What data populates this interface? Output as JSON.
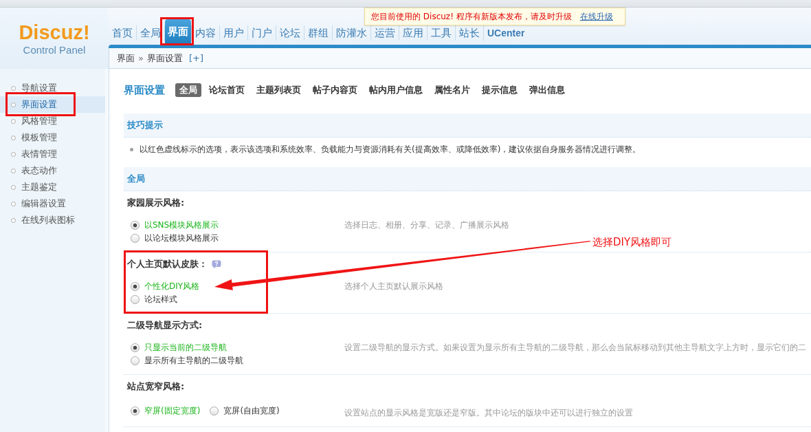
{
  "notice": {
    "text": "您目前使用的 Discuz! 程序有新版本发布，请及时升级",
    "link": "在线升级"
  },
  "logo": {
    "title": "Discuz!",
    "subtitle": "Control Panel"
  },
  "nav": [
    {
      "label": "首页",
      "kind": "menu",
      "selected": false,
      "marked": false
    },
    {
      "label": "全局",
      "kind": "menu",
      "selected": false,
      "marked": false
    },
    {
      "label": "界面",
      "kind": "menu",
      "selected": true,
      "marked": true
    },
    {
      "label": "内容",
      "kind": "menu",
      "selected": false,
      "marked": false
    },
    {
      "label": "用户",
      "kind": "menu",
      "selected": false,
      "marked": false
    },
    {
      "label": "门户",
      "kind": "menu",
      "selected": false,
      "marked": false
    },
    {
      "label": "论坛",
      "kind": "menu",
      "selected": false,
      "marked": false
    },
    {
      "label": "群组",
      "kind": "menu",
      "selected": false,
      "marked": false
    },
    {
      "label": "防灌水",
      "kind": "menu",
      "selected": false,
      "marked": false
    },
    {
      "label": "运营",
      "kind": "menu",
      "selected": false,
      "marked": false
    },
    {
      "label": "应用",
      "kind": "menu",
      "selected": false,
      "marked": false
    },
    {
      "label": "工具",
      "kind": "menu",
      "selected": false,
      "marked": false
    },
    {
      "label": "站长",
      "kind": "menu",
      "selected": false,
      "marked": false
    },
    {
      "label": "UCenter",
      "kind": "app",
      "selected": false,
      "marked": false
    }
  ],
  "breadcrumb": {
    "items": [
      "界面",
      "界面设置"
    ],
    "separator": "»",
    "toggle": "[+]"
  },
  "sidebar": {
    "items": [
      {
        "label": "导航设置",
        "selected": false,
        "marked": false
      },
      {
        "label": "界面设置",
        "selected": true,
        "marked": true
      },
      {
        "label": "风格管理",
        "selected": false,
        "marked": false
      },
      {
        "label": "模板管理",
        "selected": false,
        "marked": false
      },
      {
        "label": "表情管理",
        "selected": false,
        "marked": false
      },
      {
        "label": "表态动作",
        "selected": false,
        "marked": false
      },
      {
        "label": "主题鉴定",
        "selected": false,
        "marked": false
      },
      {
        "label": "编辑器设置",
        "selected": false,
        "marked": false
      },
      {
        "label": "在线列表图标",
        "selected": false,
        "marked": false
      }
    ]
  },
  "page": {
    "title": "界面设置",
    "tabs": [
      {
        "label": "全局",
        "selected": true
      },
      {
        "label": "论坛首页",
        "selected": false
      },
      {
        "label": "主题列表页",
        "selected": false
      },
      {
        "label": "帖子内容页",
        "selected": false
      },
      {
        "label": "帖内用户信息",
        "selected": false
      },
      {
        "label": "属性名片",
        "selected": false
      },
      {
        "label": "提示信息",
        "selected": false
      },
      {
        "label": "弹出信息",
        "selected": false
      }
    ]
  },
  "tips": {
    "title": "技巧提示",
    "items": [
      "以红色虚线标示的选项，表示该选项和系统效率、负载能力与资源消耗有关(提高效率、或降低效率)，建议依据自身服务器情况进行调整。"
    ]
  },
  "settings_section": {
    "title": "全局",
    "settings": [
      {
        "label": "家园展示风格:",
        "kind": "stacked",
        "help": false,
        "marked": false,
        "options": [
          {
            "label": "以SNS模块风格展示",
            "selected": true
          },
          {
            "label": "以论坛模块风格展示",
            "selected": false
          }
        ],
        "description": "选择日志、相册、分享、记录、广播展示风格"
      },
      {
        "label": "个人主页默认皮肤：",
        "kind": "stacked",
        "help": true,
        "marked": true,
        "note": "选择DIY风格即可",
        "options": [
          {
            "label": "个性化DIY风格",
            "selected": true
          },
          {
            "label": "论坛样式",
            "selected": false
          }
        ],
        "description": "选择个人主页默认展示风格"
      },
      {
        "label": "二级导航显示方式:",
        "kind": "stacked",
        "help": false,
        "marked": false,
        "options": [
          {
            "label": "只显示当前的二级导航",
            "selected": true
          },
          {
            "label": "显示所有主导航的二级导航",
            "selected": false
          }
        ],
        "description": "设置二级导航的显示方式。如果设置为显示所有主导航的二级导航，那么会当鼠标移动到其他主导航文字上方时，显示它们的二"
      },
      {
        "label": "站点宽窄风格:",
        "kind": "inline",
        "help": false,
        "marked": false,
        "options": [
          {
            "label": "窄屏(固定宽度)",
            "selected": true
          },
          {
            "label": "宽屏(自由宽度)",
            "selected": false
          }
        ],
        "description": "设置站点的显示风格是宽版还是窄版。其中论坛的版块中还可以进行独立的设置"
      }
    ]
  }
}
